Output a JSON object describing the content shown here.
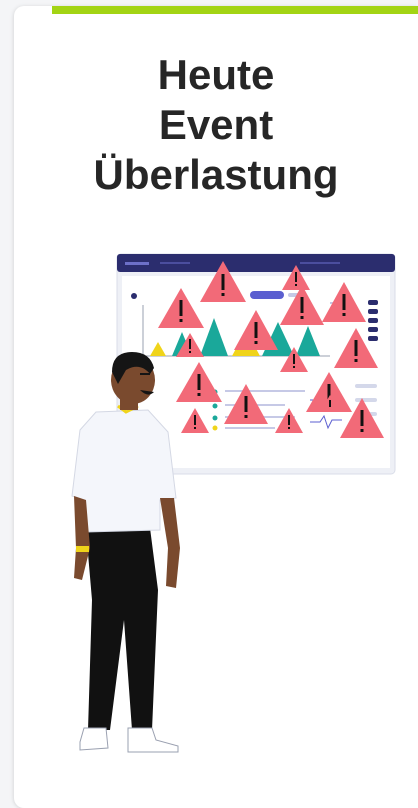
{
  "card": {
    "title_lines": [
      "Heute",
      "Event",
      "Überlastung"
    ],
    "accent_color": "#a3d414"
  },
  "illustration": {
    "subject": "person-looking-at-dashboard",
    "dashboard": {
      "warning_count": 16,
      "warning_color": "#f26a78",
      "warning_symbol": "!",
      "peak_color": "#1aa89a",
      "highlight_color": "#f0d41a"
    }
  },
  "icons": {
    "warning": "warning-triangle-icon"
  }
}
